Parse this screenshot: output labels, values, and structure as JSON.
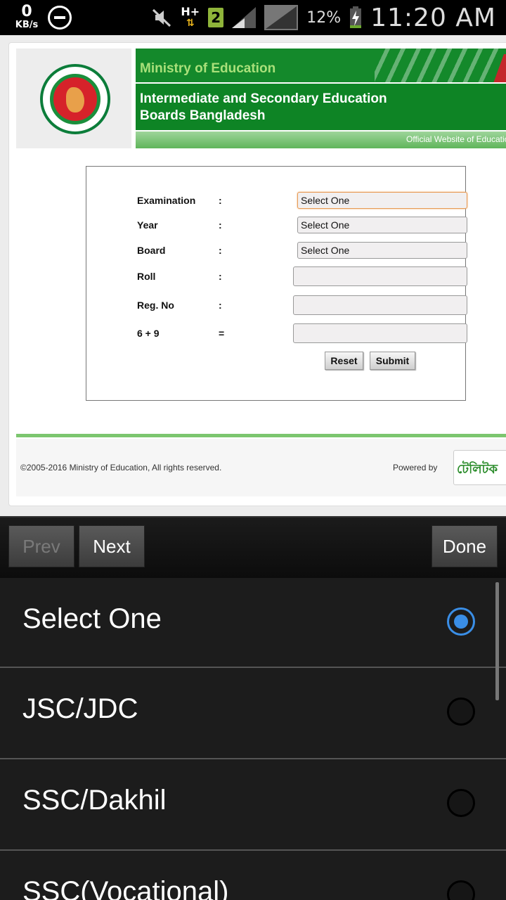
{
  "status_bar": {
    "speed_value": "0",
    "speed_unit": "KB/s",
    "network": "H+",
    "sim_slot": "2",
    "battery": "12%",
    "time": "11:20 AM"
  },
  "site": {
    "ministry": "Ministry of Education",
    "board_line1": "Intermediate and Secondary Education",
    "board_line2": "Boards Bangladesh",
    "tagline": "Official Website of Education"
  },
  "form": {
    "rows": [
      {
        "label": "Examination",
        "sep": ":",
        "value": "Select One"
      },
      {
        "label": "Year",
        "sep": ":",
        "value": "Select One"
      },
      {
        "label": "Board",
        "sep": ":",
        "value": "Select One"
      },
      {
        "label": "Roll",
        "sep": ":",
        "value": ""
      },
      {
        "label": "Reg. No",
        "sep": ":",
        "value": ""
      },
      {
        "label": "6 + 9",
        "sep": "=",
        "value": ""
      }
    ],
    "reset_label": "Reset",
    "submit_label": "Submit"
  },
  "footer": {
    "copyright": "©2005-2016 Ministry of Education, All rights reserved.",
    "powered_by": "Powered by",
    "sponsor_logo": "টেলিটক"
  },
  "picker": {
    "prev_label": "Prev",
    "next_label": "Next",
    "done_label": "Done",
    "options": [
      {
        "label": "Select One",
        "selected": true
      },
      {
        "label": "JSC/JDC",
        "selected": false
      },
      {
        "label": "SSC/Dakhil",
        "selected": false
      },
      {
        "label": "SSC(Vocational)",
        "selected": false
      }
    ]
  },
  "colors": {
    "accent_radio": "#3a8ee6",
    "header_green": "#0e8425",
    "ministry_text": "#a9e07a"
  }
}
